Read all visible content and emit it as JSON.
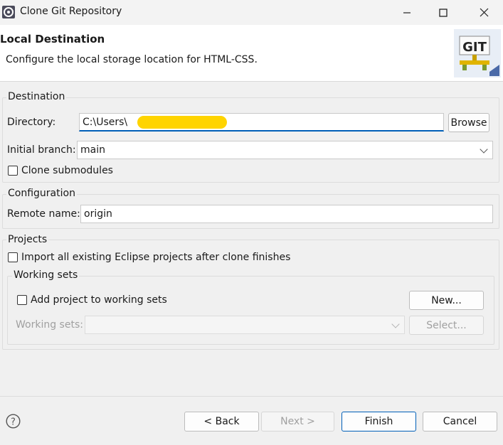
{
  "window": {
    "title": "Clone Git Repository"
  },
  "header": {
    "title": "Local Destination",
    "description": "Configure the local storage location for HTML-CSS.",
    "logo_text": "GIT"
  },
  "destination": {
    "legend": "Destination",
    "directory_label": "Directory:",
    "directory_value": "C:\\Users\\",
    "browse_label": "Browse",
    "branch_label": "Initial branch:",
    "branch_value": "main",
    "clone_submodules_label": "Clone submodules",
    "clone_submodules_checked": false
  },
  "configuration": {
    "legend": "Configuration",
    "remote_label": "Remote name:",
    "remote_value": "origin"
  },
  "projects": {
    "legend": "Projects",
    "import_label": "Import all existing Eclipse projects after clone finishes",
    "import_checked": false,
    "working_sets": {
      "legend": "Working sets",
      "add_label": "Add project to working sets",
      "add_checked": false,
      "new_label": "New...",
      "sets_label": "Working sets:",
      "select_label": "Select..."
    }
  },
  "footer": {
    "help_icon": "question-circle-icon",
    "back_label": "< Back",
    "next_label": "Next >",
    "finish_label": "Finish",
    "cancel_label": "Cancel"
  },
  "colors": {
    "accent": "#005fb8",
    "redaction": "#ffd400"
  }
}
